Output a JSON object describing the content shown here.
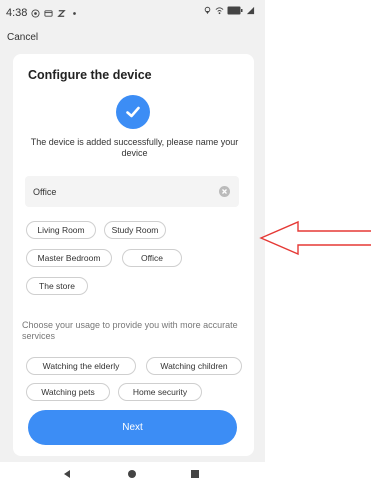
{
  "status_bar": {
    "time": "4:38",
    "left_icons": [
      "whatsapp-icon",
      "notification-icon",
      "z-icon",
      "dot-icon"
    ],
    "right_icons": [
      "location-icon",
      "wifi-icon",
      "battery-icon",
      "signal-icon"
    ]
  },
  "header": {
    "cancel_label": "Cancel"
  },
  "card": {
    "title": "Configure the device",
    "success_message": "The device is added successfully, please name your device",
    "name_field": {
      "value": "Office"
    },
    "room_suggestions": [
      "Living Room",
      "Study Room",
      "Master Bedroom",
      "Office",
      "The store"
    ],
    "usage_message": "Choose your usage to provide you with more accurate services",
    "usage_options": [
      "Watching the elderly",
      "Watching children",
      "Watching pets",
      "Home security"
    ],
    "next_label": "Next"
  },
  "annotation": {
    "arrow_color": "#e53935"
  },
  "colors": {
    "accent": "#3c8df5",
    "background": "#f1f1f1"
  }
}
